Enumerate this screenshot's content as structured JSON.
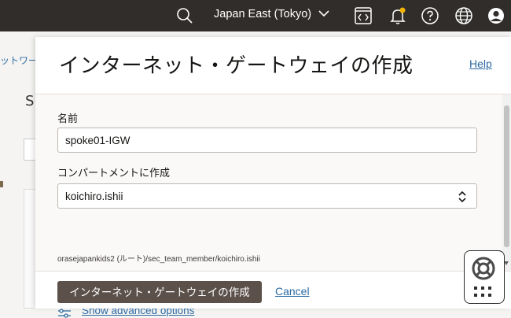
{
  "topbar": {
    "region": "Japan East (Tokyo)",
    "icons": [
      "search-icon",
      "chevron-down-icon",
      "code-editor-icon",
      "bell-icon",
      "help-icon",
      "globe-icon",
      "profile-icon"
    ],
    "notification_dot_color": "#f0b400"
  },
  "background": {
    "breadcrumb": "ットワー",
    "heading_fragment": "S"
  },
  "panel": {
    "title": "インターネット・ゲートウェイの作成",
    "help_link": "Help",
    "fields": {
      "name_label": "名前",
      "name_value": "spoke01-IGW",
      "compartment_label": "コンパートメントに作成",
      "compartment_value": "koichiro.ishii",
      "compartment_hint": "orasejapankids2 (ルート)/sec_team_member/koichiro.ishii"
    },
    "advanced_options": "Show advanced options",
    "footer": {
      "create_button": "インターネット・ゲートウェイの作成",
      "cancel_link": "Cancel"
    }
  },
  "colors": {
    "topbar_bg": "#312d2a",
    "link": "#2c6aa3",
    "primary_button": "#5b504a"
  }
}
